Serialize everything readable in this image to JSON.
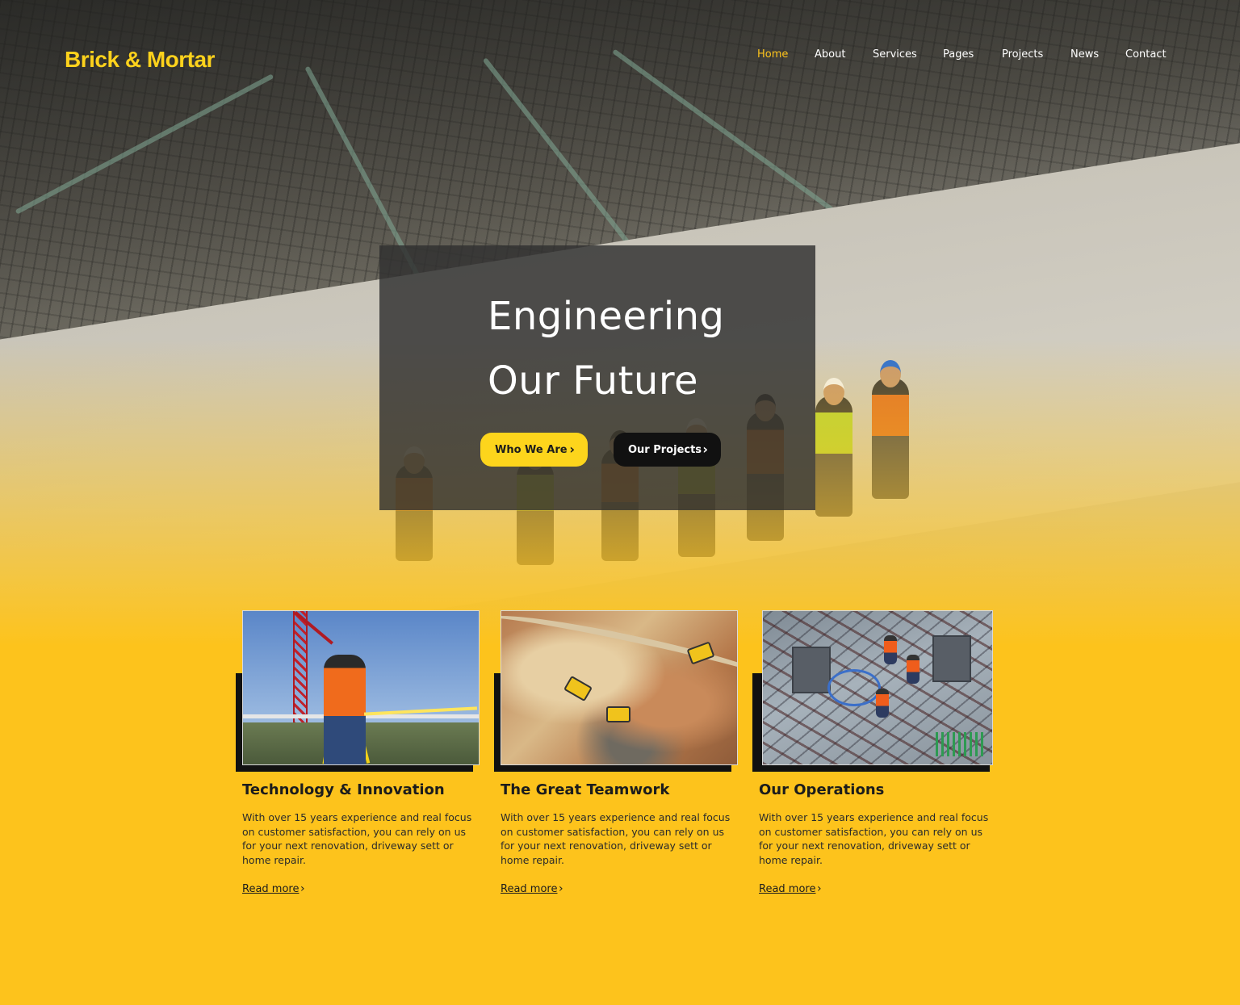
{
  "header": {
    "logo": "Brick & Mortar",
    "nav": [
      {
        "label": "Home",
        "active": true
      },
      {
        "label": "About",
        "active": false
      },
      {
        "label": "Services",
        "active": false
      },
      {
        "label": "Pages",
        "active": false
      },
      {
        "label": "Projects",
        "active": false
      },
      {
        "label": "News",
        "active": false
      },
      {
        "label": "Contact",
        "active": false
      }
    ]
  },
  "hero": {
    "headline_line1": "Engineering",
    "headline_line2": "Our Future",
    "primary_button": "Who We Are",
    "secondary_button": "Our Projects"
  },
  "cards": [
    {
      "title": "Technology & Innovation",
      "body": "With over 15 years experience and real focus on customer satisfaction, you can rely on us for your next renovation, driveway sett or home repair.",
      "link": "Read more"
    },
    {
      "title": "The Great Teamwork",
      "body": "With over 15 years experience and real focus on customer satisfaction, you can rely on us for your next renovation, driveway sett or home repair.",
      "link": "Read more"
    },
    {
      "title": "Our Operations",
      "body": "With over 15 years experience and real focus on customer satisfaction, you can rely on us for your next renovation, driveway sett or home repair.",
      "link": "Read more"
    }
  ],
  "colors": {
    "brand_yellow": "#fdc31c",
    "logo_yellow": "#fdd21c",
    "panel_dark": "#303030",
    "button_dark": "#111111"
  },
  "icons": {
    "button_arrow": "chevron-right-icon",
    "link_arrow": "chevron-right-icon"
  }
}
